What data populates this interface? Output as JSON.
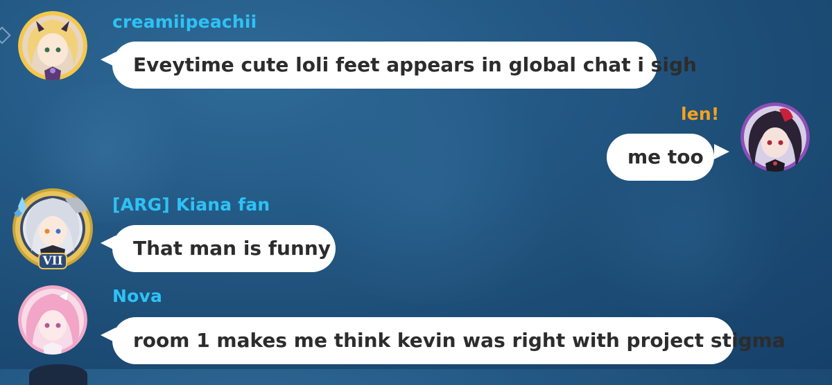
{
  "messages": [
    {
      "user": "creamiipeachii",
      "text": "Eveytime cute loli feet appears in global chat i sigh",
      "side": "left",
      "avatar_icon": "blonde-character-avatar"
    },
    {
      "user": "len!",
      "text": "me too",
      "side": "right",
      "avatar_icon": "dark-haired-character-avatar"
    },
    {
      "user": "[ARG] Kiana fan",
      "text": "That man is funny",
      "side": "left",
      "avatar_icon": "silver-haired-character-avatar",
      "badge": "VII"
    },
    {
      "user": "Nova",
      "text": "room 1 makes me think kevin was right with project stigma",
      "side": "left",
      "avatar_icon": "pink-haired-character-avatar"
    }
  ],
  "colors": {
    "username_default": "#2ec2f5",
    "username_self": "#f6a21d",
    "bubble": "#ffffff",
    "bubble_text": "#2c2c2c",
    "background": "#245985"
  }
}
